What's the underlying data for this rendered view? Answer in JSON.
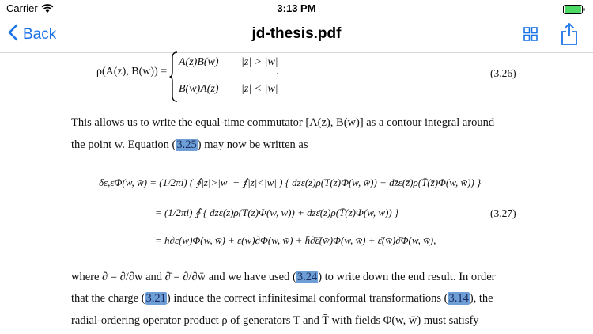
{
  "status_bar": {
    "carrier": "Carrier",
    "time": "3:13 PM"
  },
  "nav": {
    "back_label": "Back",
    "title": "jd-thesis.pdf",
    "icons": [
      "chevron-left-icon",
      "grid-icon",
      "share-icon"
    ],
    "accent_color": "#1a73e8"
  },
  "doc": {
    "eq326": {
      "lhs": "ρ(A(z), B(w)) =",
      "case1_expr": "A(z)B(w)",
      "case1_cond": "|z| > |w|",
      "case2_expr": "B(w)A(z)",
      "case2_cond": "|z| < |w|",
      "period": ".",
      "number": "(3.26)"
    },
    "para1": {
      "line1": "This allows us to write the equal-time commutator [A(z), B(w)] as a contour integral around",
      "line2_a": "the point w. Equation (",
      "link": "3.25",
      "line2_b": ") may now be written as"
    },
    "eq327": {
      "line1": "δε,ε̄Φ(w, w̄) = (1/2πi) ( ∮|z|>|w| − ∮|z|<|w| ) { dzε(z)ρ(T(z)Φ(w, w̄)) + dz̄ε̄(z̄)ρ(T̄(z̄)Φ(w, w̄)) }",
      "line2": "= (1/2πi) ∮ { dzε(z)ρ(T(z)Φ(w, w̄)) + dz̄ε̄(z̄)ρ(T̄(z̄)Φ(w, w̄)) }",
      "line3": "= h∂ε(w)Φ(w, w̄) + ε(w)∂Φ(w, w̄) + h̄∂̄ε̄(w̄)Φ(w, w̄) + ε̄(w̄)∂̄Φ(w, w̄),",
      "number": "(3.27)"
    },
    "para2": {
      "l1_a": "where ∂ = ∂/∂w and ∂̄ = ∂/∂w̄ and we have used (",
      "link1": "3.24",
      "l1_b": ") to write down the end result. In order",
      "l2_a": "that the charge (",
      "link2": "3.21",
      "l2_b": ") induce the correct infinitesimal conformal transformations (",
      "link3": "3.14",
      "l2_c": "), the",
      "l3": "radial-ordering operator product ρ of generators T and T̄ with fields Φ(w, w̄) must satisfy"
    },
    "highlight_color": "#6d9fd6"
  }
}
